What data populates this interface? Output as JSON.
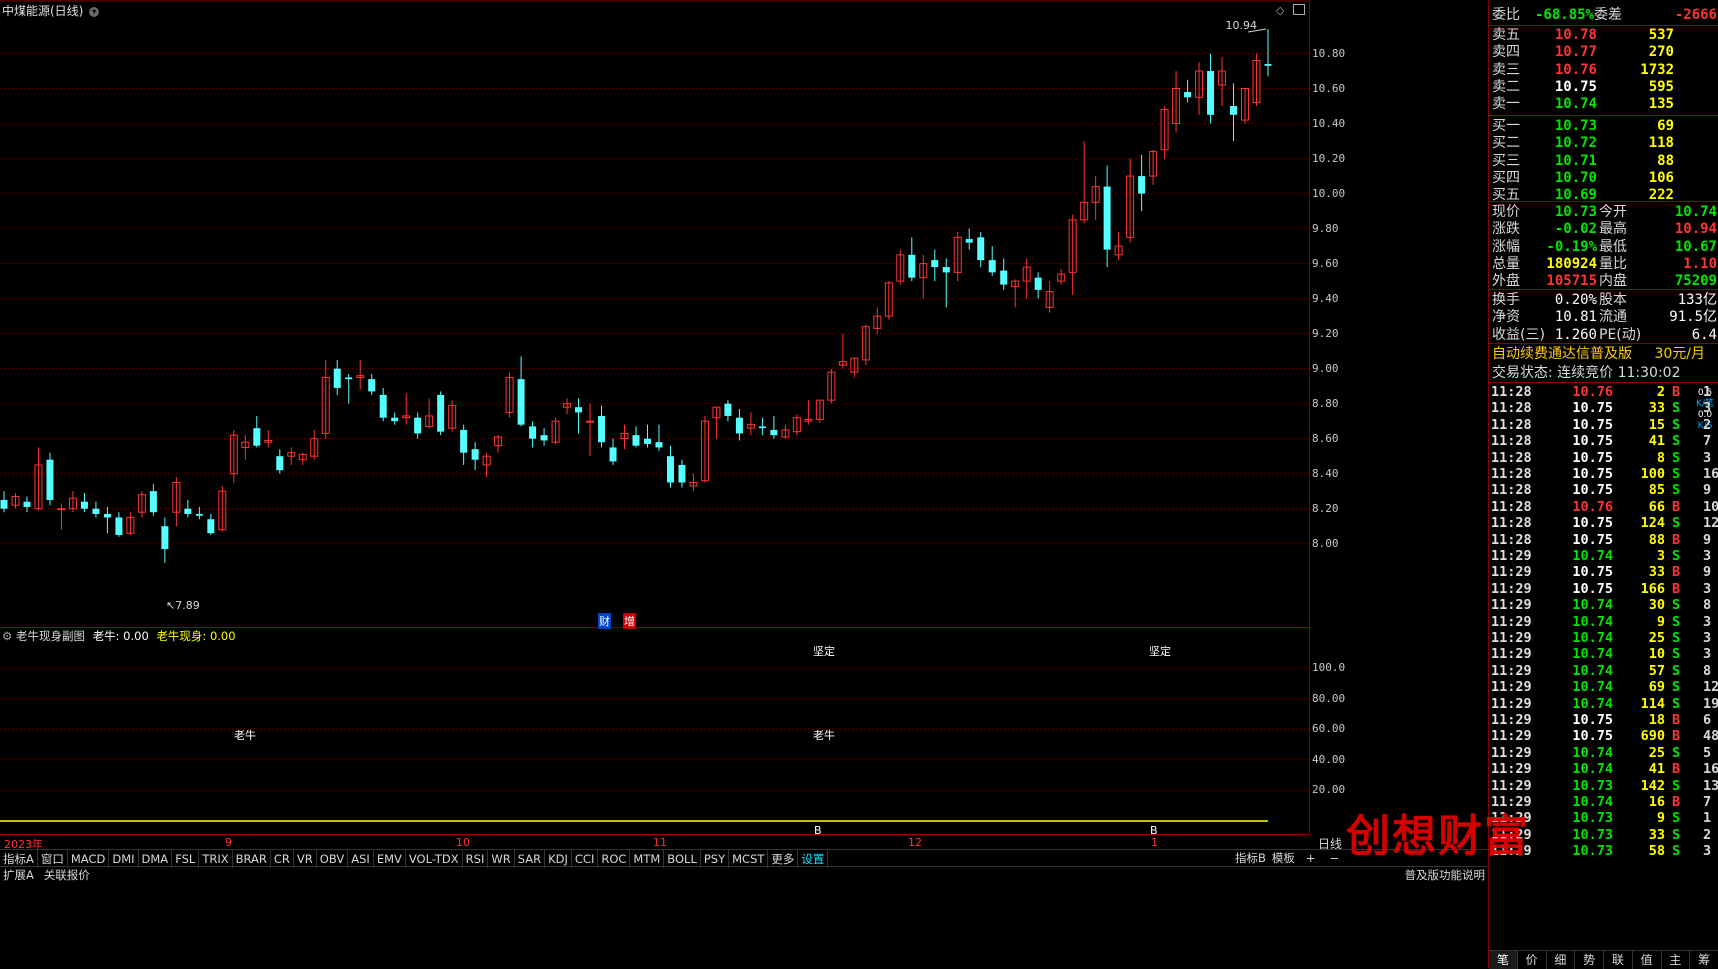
{
  "window": {
    "title": "中煤能源(日线)"
  },
  "main_chart": {
    "y_ticks": [
      "10.80",
      "10.60",
      "10.40",
      "10.20",
      "10.00",
      "9.80",
      "9.60",
      "9.40",
      "9.20",
      "9.00",
      "8.80",
      "8.60",
      "8.40",
      "8.20",
      "8.00"
    ],
    "high_label": "10.94",
    "low_label": "7.89",
    "markers": [
      "财",
      "增"
    ]
  },
  "sub_chart": {
    "title": "老牛现身副图",
    "v1_label": "老牛: 0.00",
    "v2_label": "老牛现身: 0.00",
    "y_ticks": [
      "100.0",
      "80.00",
      "60.00",
      "40.00",
      "20.00"
    ],
    "annotations": [
      "坚定",
      "坚定",
      "老牛",
      "老牛",
      "B",
      "B"
    ]
  },
  "x_axis": {
    "labels": [
      "2023年",
      "9",
      "10",
      "11",
      "12",
      "1"
    ],
    "period": "日线"
  },
  "indicator_bar": [
    "指标A",
    "窗口",
    "MACD",
    "DMI",
    "DMA",
    "FSL",
    "TRIX",
    "BRAR",
    "CR",
    "VR",
    "OBV",
    "ASI",
    "EMV",
    "VOL-TDX",
    "RSI",
    "WR",
    "SAR",
    "KDJ",
    "CCI",
    "ROC",
    "MTM",
    "BOLL",
    "PSY",
    "MCST",
    "更多",
    "设置"
  ],
  "indicator_bar_right": [
    "指标B",
    "模板",
    "+",
    "−"
  ],
  "status_bar": {
    "left": [
      "扩展A",
      "关联报价"
    ],
    "right": "普及版功能说明"
  },
  "quote": {
    "weibi": {
      "label": "委比",
      "value": "-68.85%",
      "label2": "委差",
      "value2": "-2666"
    },
    "asks": [
      {
        "label": "卖五",
        "price": "10.78",
        "vol": "537"
      },
      {
        "label": "卖四",
        "price": "10.77",
        "vol": "270"
      },
      {
        "label": "卖三",
        "price": "10.76",
        "vol": "1732"
      },
      {
        "label": "卖二",
        "price": "10.75",
        "vol": "595"
      },
      {
        "label": "卖一",
        "price": "10.74",
        "vol": "135"
      }
    ],
    "bids": [
      {
        "label": "买一",
        "price": "10.73",
        "vol": "69"
      },
      {
        "label": "买二",
        "price": "10.72",
        "vol": "118"
      },
      {
        "label": "买三",
        "price": "10.71",
        "vol": "88"
      },
      {
        "label": "买四",
        "price": "10.70",
        "vol": "106"
      },
      {
        "label": "买五",
        "price": "10.69",
        "vol": "222"
      }
    ],
    "stats": [
      {
        "l1": "现价",
        "v1": "10.73",
        "l2": "今开",
        "v2": "10.74"
      },
      {
        "l1": "涨跌",
        "v1": "-0.02",
        "l2": "最高",
        "v2": "10.94"
      },
      {
        "l1": "涨幅",
        "v1": "-0.19%",
        "l2": "最低",
        "v2": "10.67"
      },
      {
        "l1": "总量",
        "v1": "180924",
        "l2": "量比",
        "v2": "1.10"
      },
      {
        "l1": "外盘",
        "v1": "105715",
        "l2": "内盘",
        "v2": "75209"
      }
    ],
    "stats2": [
      {
        "l1": "换手",
        "v1": "0.20%",
        "l2": "股本",
        "v2": "133亿"
      },
      {
        "l1": "净资",
        "v1": "10.81",
        "l2": "流通",
        "v2": "91.5亿"
      },
      {
        "l1": "收益(三)",
        "v1": "1.260",
        "l2": "PE(动)",
        "v2": "6.4"
      }
    ],
    "ad": {
      "text": "自动续费通达信普及版",
      "price": "30元/月"
    },
    "trade_state": "交易状态: 连续竞价 11:30:02",
    "side_stats": [
      "0.5",
      "K/笔",
      "0.0",
      "K/S"
    ]
  },
  "ticks": [
    {
      "t": "11:28",
      "p": "10.76",
      "v": "2",
      "bs": "B",
      "n": "1"
    },
    {
      "t": "11:28",
      "p": "10.75",
      "v": "33",
      "bs": "S",
      "n": "3"
    },
    {
      "t": "11:28",
      "p": "10.75",
      "v": "15",
      "bs": "S",
      "n": "2"
    },
    {
      "t": "11:28",
      "p": "10.75",
      "v": "41",
      "bs": "S",
      "n": "7"
    },
    {
      "t": "11:28",
      "p": "10.75",
      "v": "8",
      "bs": "S",
      "n": "3"
    },
    {
      "t": "11:28",
      "p": "10.75",
      "v": "100",
      "bs": "S",
      "n": "16"
    },
    {
      "t": "11:28",
      "p": "10.75",
      "v": "85",
      "bs": "S",
      "n": "9"
    },
    {
      "t": "11:28",
      "p": "10.76",
      "v": "66",
      "bs": "B",
      "n": "10"
    },
    {
      "t": "11:28",
      "p": "10.75",
      "v": "124",
      "bs": "S",
      "n": "12"
    },
    {
      "t": "11:28",
      "p": "10.75",
      "v": "88",
      "bs": "B",
      "n": "9"
    },
    {
      "t": "11:29",
      "p": "10.74",
      "v": "3",
      "bs": "S",
      "n": "3"
    },
    {
      "t": "11:29",
      "p": "10.75",
      "v": "33",
      "bs": "B",
      "n": "9"
    },
    {
      "t": "11:29",
      "p": "10.75",
      "v": "166",
      "bs": "B",
      "n": "3"
    },
    {
      "t": "11:29",
      "p": "10.74",
      "v": "30",
      "bs": "S",
      "n": "8"
    },
    {
      "t": "11:29",
      "p": "10.74",
      "v": "9",
      "bs": "S",
      "n": "3"
    },
    {
      "t": "11:29",
      "p": "10.74",
      "v": "25",
      "bs": "S",
      "n": "3"
    },
    {
      "t": "11:29",
      "p": "10.74",
      "v": "10",
      "bs": "S",
      "n": "3"
    },
    {
      "t": "11:29",
      "p": "10.74",
      "v": "57",
      "bs": "S",
      "n": "8"
    },
    {
      "t": "11:29",
      "p": "10.74",
      "v": "69",
      "bs": "S",
      "n": "12"
    },
    {
      "t": "11:29",
      "p": "10.74",
      "v": "114",
      "bs": "S",
      "n": "19"
    },
    {
      "t": "11:29",
      "p": "10.75",
      "v": "18",
      "bs": "B",
      "n": "6"
    },
    {
      "t": "11:29",
      "p": "10.75",
      "v": "690",
      "bs": "B",
      "n": "48"
    },
    {
      "t": "11:29",
      "p": "10.74",
      "v": "25",
      "bs": "S",
      "n": "5"
    },
    {
      "t": "11:29",
      "p": "10.74",
      "v": "41",
      "bs": "B",
      "n": "16"
    },
    {
      "t": "11:29",
      "p": "10.73",
      "v": "142",
      "bs": "S",
      "n": "13"
    },
    {
      "t": "11:29",
      "p": "10.74",
      "v": "16",
      "bs": "B",
      "n": "7"
    },
    {
      "t": "11:29",
      "p": "10.73",
      "v": "9",
      "bs": "S",
      "n": "1"
    },
    {
      "t": "11:29",
      "p": "10.73",
      "v": "33",
      "bs": "S",
      "n": "2"
    },
    {
      "t": "11:29",
      "p": "10.73",
      "v": "58",
      "bs": "S",
      "n": "3"
    }
  ],
  "bottom_tabs": [
    "笔",
    "价",
    "细",
    "势",
    "联",
    "值",
    "主",
    "筹"
  ],
  "watermark": "创想财富",
  "colors": {
    "up": "#ff3333",
    "down": "#54ffff",
    "grid": "#800000",
    "mid": "#ffff00"
  },
  "candles": [
    {
      "o": 8.25,
      "h": 8.3,
      "l": 8.18,
      "c": 8.2
    },
    {
      "o": 8.22,
      "h": 8.29,
      "l": 8.2,
      "c": 8.27
    },
    {
      "o": 8.24,
      "h": 8.27,
      "l": 8.18,
      "c": 8.21
    },
    {
      "o": 8.2,
      "h": 8.55,
      "l": 8.19,
      "c": 8.45
    },
    {
      "o": 8.48,
      "h": 8.52,
      "l": 8.22,
      "c": 8.25
    },
    {
      "o": 8.2,
      "h": 8.23,
      "l": 8.08,
      "c": 8.2
    },
    {
      "o": 8.2,
      "h": 8.3,
      "l": 8.18,
      "c": 8.26
    },
    {
      "o": 8.24,
      "h": 8.29,
      "l": 8.18,
      "c": 8.2
    },
    {
      "o": 8.2,
      "h": 8.24,
      "l": 8.15,
      "c": 8.17
    },
    {
      "o": 8.17,
      "h": 8.21,
      "l": 8.06,
      "c": 8.15
    },
    {
      "o": 8.15,
      "h": 8.18,
      "l": 8.04,
      "c": 8.05
    },
    {
      "o": 8.06,
      "h": 8.18,
      "l": 8.05,
      "c": 8.15
    },
    {
      "o": 8.18,
      "h": 8.3,
      "l": 8.15,
      "c": 8.28
    },
    {
      "o": 8.3,
      "h": 8.34,
      "l": 8.16,
      "c": 8.18
    },
    {
      "o": 8.1,
      "h": 8.15,
      "l": 7.89,
      "c": 7.97
    },
    {
      "o": 8.18,
      "h": 8.38,
      "l": 8.1,
      "c": 8.35
    },
    {
      "o": 8.2,
      "h": 8.25,
      "l": 8.15,
      "c": 8.17
    },
    {
      "o": 8.17,
      "h": 8.21,
      "l": 8.14,
      "c": 8.16
    },
    {
      "o": 8.14,
      "h": 8.17,
      "l": 8.05,
      "c": 8.06
    },
    {
      "o": 8.08,
      "h": 8.33,
      "l": 8.07,
      "c": 8.3
    },
    {
      "o": 8.4,
      "h": 8.65,
      "l": 8.35,
      "c": 8.62
    },
    {
      "o": 8.55,
      "h": 8.62,
      "l": 8.48,
      "c": 8.58
    },
    {
      "o": 8.66,
      "h": 8.73,
      "l": 8.55,
      "c": 8.56
    },
    {
      "o": 8.58,
      "h": 8.65,
      "l": 8.55,
      "c": 8.59
    },
    {
      "o": 8.5,
      "h": 8.54,
      "l": 8.4,
      "c": 8.42
    },
    {
      "o": 8.5,
      "h": 8.55,
      "l": 8.45,
      "c": 8.52
    },
    {
      "o": 8.48,
      "h": 8.52,
      "l": 8.45,
      "c": 8.51
    },
    {
      "o": 8.5,
      "h": 8.65,
      "l": 8.48,
      "c": 8.6
    },
    {
      "o": 8.63,
      "h": 9.05,
      "l": 8.6,
      "c": 8.95
    },
    {
      "o": 9.0,
      "h": 9.05,
      "l": 8.85,
      "c": 8.89
    },
    {
      "o": 8.95,
      "h": 8.97,
      "l": 8.8,
      "c": 8.94
    },
    {
      "o": 8.95,
      "h": 9.05,
      "l": 8.88,
      "c": 8.96
    },
    {
      "o": 8.94,
      "h": 8.97,
      "l": 8.85,
      "c": 8.87
    },
    {
      "o": 8.85,
      "h": 8.89,
      "l": 8.7,
      "c": 8.72
    },
    {
      "o": 8.72,
      "h": 8.75,
      "l": 8.68,
      "c": 8.7
    },
    {
      "o": 8.72,
      "h": 8.86,
      "l": 8.68,
      "c": 8.73
    },
    {
      "o": 8.72,
      "h": 8.75,
      "l": 8.6,
      "c": 8.63
    },
    {
      "o": 8.67,
      "h": 8.83,
      "l": 8.66,
      "c": 8.73
    },
    {
      "o": 8.85,
      "h": 8.87,
      "l": 8.62,
      "c": 8.64
    },
    {
      "o": 8.66,
      "h": 8.82,
      "l": 8.64,
      "c": 8.79
    },
    {
      "o": 8.65,
      "h": 8.68,
      "l": 8.45,
      "c": 8.52
    },
    {
      "o": 8.54,
      "h": 8.58,
      "l": 8.42,
      "c": 8.48
    },
    {
      "o": 8.45,
      "h": 8.52,
      "l": 8.38,
      "c": 8.5
    },
    {
      "o": 8.56,
      "h": 8.62,
      "l": 8.52,
      "c": 8.61
    },
    {
      "o": 8.75,
      "h": 8.98,
      "l": 8.72,
      "c": 8.95
    },
    {
      "o": 8.94,
      "h": 9.07,
      "l": 8.67,
      "c": 8.68
    },
    {
      "o": 8.67,
      "h": 8.7,
      "l": 8.55,
      "c": 8.6
    },
    {
      "o": 8.62,
      "h": 8.66,
      "l": 8.56,
      "c": 8.59
    },
    {
      "o": 8.58,
      "h": 8.72,
      "l": 8.57,
      "c": 8.7
    },
    {
      "o": 8.78,
      "h": 8.83,
      "l": 8.74,
      "c": 8.8
    },
    {
      "o": 8.78,
      "h": 8.83,
      "l": 8.63,
      "c": 8.75
    },
    {
      "o": 8.7,
      "h": 8.8,
      "l": 8.5,
      "c": 8.7
    },
    {
      "o": 8.73,
      "h": 8.79,
      "l": 8.55,
      "c": 8.58
    },
    {
      "o": 8.55,
      "h": 8.6,
      "l": 8.45,
      "c": 8.47
    },
    {
      "o": 8.6,
      "h": 8.68,
      "l": 8.54,
      "c": 8.63
    },
    {
      "o": 8.62,
      "h": 8.67,
      "l": 8.55,
      "c": 8.56
    },
    {
      "o": 8.6,
      "h": 8.68,
      "l": 8.55,
      "c": 8.57
    },
    {
      "o": 8.58,
      "h": 8.68,
      "l": 8.53,
      "c": 8.55
    },
    {
      "o": 8.5,
      "h": 8.56,
      "l": 8.32,
      "c": 8.35
    },
    {
      "o": 8.45,
      "h": 8.48,
      "l": 8.32,
      "c": 8.35
    },
    {
      "o": 8.33,
      "h": 8.4,
      "l": 8.3,
      "c": 8.35
    },
    {
      "o": 8.36,
      "h": 8.73,
      "l": 8.35,
      "c": 8.7
    },
    {
      "o": 8.72,
      "h": 8.78,
      "l": 8.6,
      "c": 8.78
    },
    {
      "o": 8.8,
      "h": 8.82,
      "l": 8.7,
      "c": 8.73
    },
    {
      "o": 8.72,
      "h": 8.77,
      "l": 8.59,
      "c": 8.63
    },
    {
      "o": 8.66,
      "h": 8.75,
      "l": 8.62,
      "c": 8.68
    },
    {
      "o": 8.67,
      "h": 8.72,
      "l": 8.62,
      "c": 8.66
    },
    {
      "o": 8.65,
      "h": 8.73,
      "l": 8.6,
      "c": 8.62
    },
    {
      "o": 8.61,
      "h": 8.68,
      "l": 8.6,
      "c": 8.65
    },
    {
      "o": 8.64,
      "h": 8.74,
      "l": 8.62,
      "c": 8.72
    },
    {
      "o": 8.7,
      "h": 8.82,
      "l": 8.68,
      "c": 8.71
    },
    {
      "o": 8.71,
      "h": 8.82,
      "l": 8.69,
      "c": 8.82
    },
    {
      "o": 8.82,
      "h": 9.0,
      "l": 8.8,
      "c": 8.98
    },
    {
      "o": 9.02,
      "h": 9.2,
      "l": 9.0,
      "c": 9.04
    },
    {
      "o": 8.98,
      "h": 9.06,
      "l": 8.95,
      "c": 9.06
    },
    {
      "o": 9.05,
      "h": 9.25,
      "l": 9.02,
      "c": 9.24
    },
    {
      "o": 9.23,
      "h": 9.35,
      "l": 9.2,
      "c": 9.3
    },
    {
      "o": 9.3,
      "h": 9.5,
      "l": 9.28,
      "c": 9.49
    },
    {
      "o": 9.5,
      "h": 9.68,
      "l": 9.48,
      "c": 9.65
    },
    {
      "o": 9.65,
      "h": 9.75,
      "l": 9.5,
      "c": 9.52
    },
    {
      "o": 9.52,
      "h": 9.65,
      "l": 9.4,
      "c": 9.6
    },
    {
      "o": 9.62,
      "h": 9.68,
      "l": 9.5,
      "c": 9.58
    },
    {
      "o": 9.58,
      "h": 9.63,
      "l": 9.35,
      "c": 9.55
    },
    {
      "o": 9.55,
      "h": 9.78,
      "l": 9.5,
      "c": 9.75
    },
    {
      "o": 9.74,
      "h": 9.8,
      "l": 9.68,
      "c": 9.72
    },
    {
      "o": 9.75,
      "h": 9.78,
      "l": 9.58,
      "c": 9.62
    },
    {
      "o": 9.62,
      "h": 9.7,
      "l": 9.53,
      "c": 9.55
    },
    {
      "o": 9.56,
      "h": 9.63,
      "l": 9.45,
      "c": 9.48
    },
    {
      "o": 9.47,
      "h": 9.51,
      "l": 9.35,
      "c": 9.5
    },
    {
      "o": 9.5,
      "h": 9.63,
      "l": 9.4,
      "c": 9.58
    },
    {
      "o": 9.52,
      "h": 9.55,
      "l": 9.4,
      "c": 9.45
    },
    {
      "o": 9.35,
      "h": 9.5,
      "l": 9.32,
      "c": 9.44
    },
    {
      "o": 9.5,
      "h": 9.57,
      "l": 9.48,
      "c": 9.54
    },
    {
      "o": 9.55,
      "h": 9.88,
      "l": 9.42,
      "c": 9.85
    },
    {
      "o": 9.85,
      "h": 10.3,
      "l": 9.83,
      "c": 9.95
    },
    {
      "o": 9.95,
      "h": 10.1,
      "l": 9.85,
      "c": 10.04
    },
    {
      "o": 10.04,
      "h": 10.16,
      "l": 9.58,
      "c": 9.68
    },
    {
      "o": 9.65,
      "h": 9.78,
      "l": 9.62,
      "c": 9.7
    },
    {
      "o": 9.75,
      "h": 10.2,
      "l": 9.72,
      "c": 10.1
    },
    {
      "o": 10.1,
      "h": 10.22,
      "l": 9.9,
      "c": 10.0
    },
    {
      "o": 10.1,
      "h": 10.25,
      "l": 10.05,
      "c": 10.24
    },
    {
      "o": 10.25,
      "h": 10.5,
      "l": 10.2,
      "c": 10.48
    },
    {
      "o": 10.4,
      "h": 10.7,
      "l": 10.35,
      "c": 10.6
    },
    {
      "o": 10.58,
      "h": 10.65,
      "l": 10.52,
      "c": 10.55
    },
    {
      "o": 10.55,
      "h": 10.75,
      "l": 10.45,
      "c": 10.7
    },
    {
      "o": 10.7,
      "h": 10.8,
      "l": 10.4,
      "c": 10.45
    },
    {
      "o": 10.62,
      "h": 10.78,
      "l": 10.5,
      "c": 10.7
    },
    {
      "o": 10.5,
      "h": 10.63,
      "l": 10.3,
      "c": 10.45
    },
    {
      "o": 10.42,
      "h": 10.6,
      "l": 10.4,
      "c": 10.6
    },
    {
      "o": 10.52,
      "h": 10.8,
      "l": 10.5,
      "c": 10.76
    },
    {
      "o": 10.74,
      "h": 10.94,
      "l": 10.67,
      "c": 10.73
    }
  ]
}
